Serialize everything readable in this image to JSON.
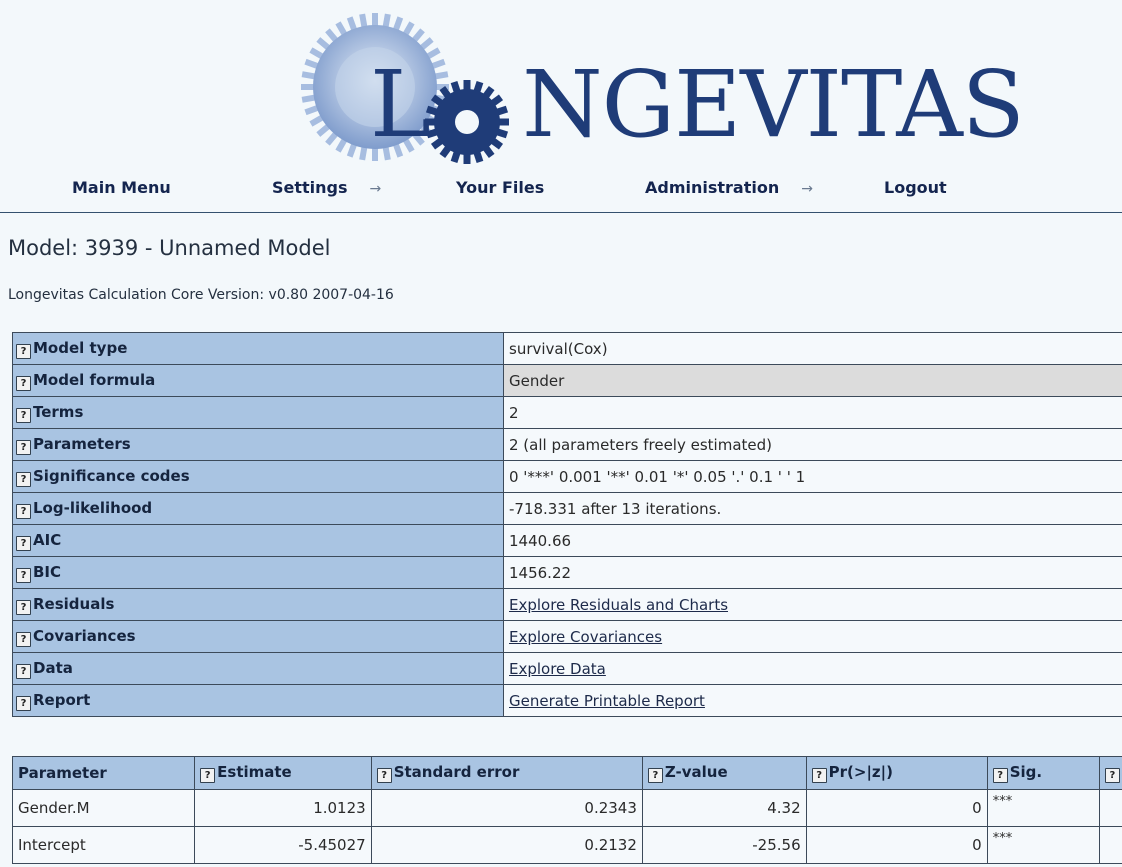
{
  "brand": {
    "logo_text": "LONGEVITAS",
    "logo_left": "L",
    "logo_right": "NGEVITAS"
  },
  "colors": {
    "brand_blue": "#1f3c78",
    "header_row_bg": "#a9c4e2",
    "highlight_row_bg": "#dcdcdc"
  },
  "nav": {
    "items": [
      {
        "label": "Main Menu",
        "has_arrow": false
      },
      {
        "label": "Settings",
        "has_arrow": true
      },
      {
        "label": "Your Files",
        "has_arrow": false
      },
      {
        "label": "Administration",
        "has_arrow": true
      },
      {
        "label": "Logout",
        "has_arrow": false
      }
    ],
    "arrow_glyph": "→"
  },
  "page": {
    "title": "Model: 3939 - Unnamed Model",
    "version": "Longevitas Calculation Core Version: v0.80 2007-04-16"
  },
  "info_rows": [
    {
      "key": "Model type",
      "value": "survival(Cox)"
    },
    {
      "key": "Model formula",
      "value": "Gender",
      "highlight": true
    },
    {
      "key": "Terms",
      "value": "2"
    },
    {
      "key": "Parameters",
      "value": "2 (all parameters freely estimated)"
    },
    {
      "key": "Significance codes",
      "value": "0 '***' 0.001 '**' 0.01 '*' 0.05 '.' 0.1 ' ' 1"
    },
    {
      "key": "Log-likelihood",
      "value": "-718.331 after 13 iterations."
    },
    {
      "key": "AIC",
      "value": "1440.66"
    },
    {
      "key": "BIC",
      "value": "1456.22"
    },
    {
      "key": "Residuals",
      "value": "Explore Residuals and Charts",
      "link": true
    },
    {
      "key": "Covariances",
      "value": "Explore Covariances",
      "link": true
    },
    {
      "key": "Data",
      "value": "Explore Data",
      "link": true
    },
    {
      "key": "Report",
      "value": "Generate Printable Report",
      "link": true
    }
  ],
  "help_glyph": "?",
  "params_table": {
    "headers": [
      {
        "label": "Parameter",
        "help": false
      },
      {
        "label": "Estimate",
        "help": true
      },
      {
        "label": "Standard error",
        "help": true
      },
      {
        "label": "Z-value",
        "help": true
      },
      {
        "label": "Pr(>|z|)",
        "help": true
      },
      {
        "label": "Sig.",
        "help": true
      },
      {
        "label": "",
        "help": true
      }
    ],
    "rows": [
      {
        "parameter": "Gender.M",
        "estimate": "1.0123",
        "std_error": "0.2343",
        "z_value": "4.32",
        "p_value": "0",
        "sig": "***"
      },
      {
        "parameter": "Intercept",
        "estimate": "-5.45027",
        "std_error": "0.2132",
        "z_value": "-25.56",
        "p_value": "0",
        "sig": "***"
      }
    ]
  }
}
